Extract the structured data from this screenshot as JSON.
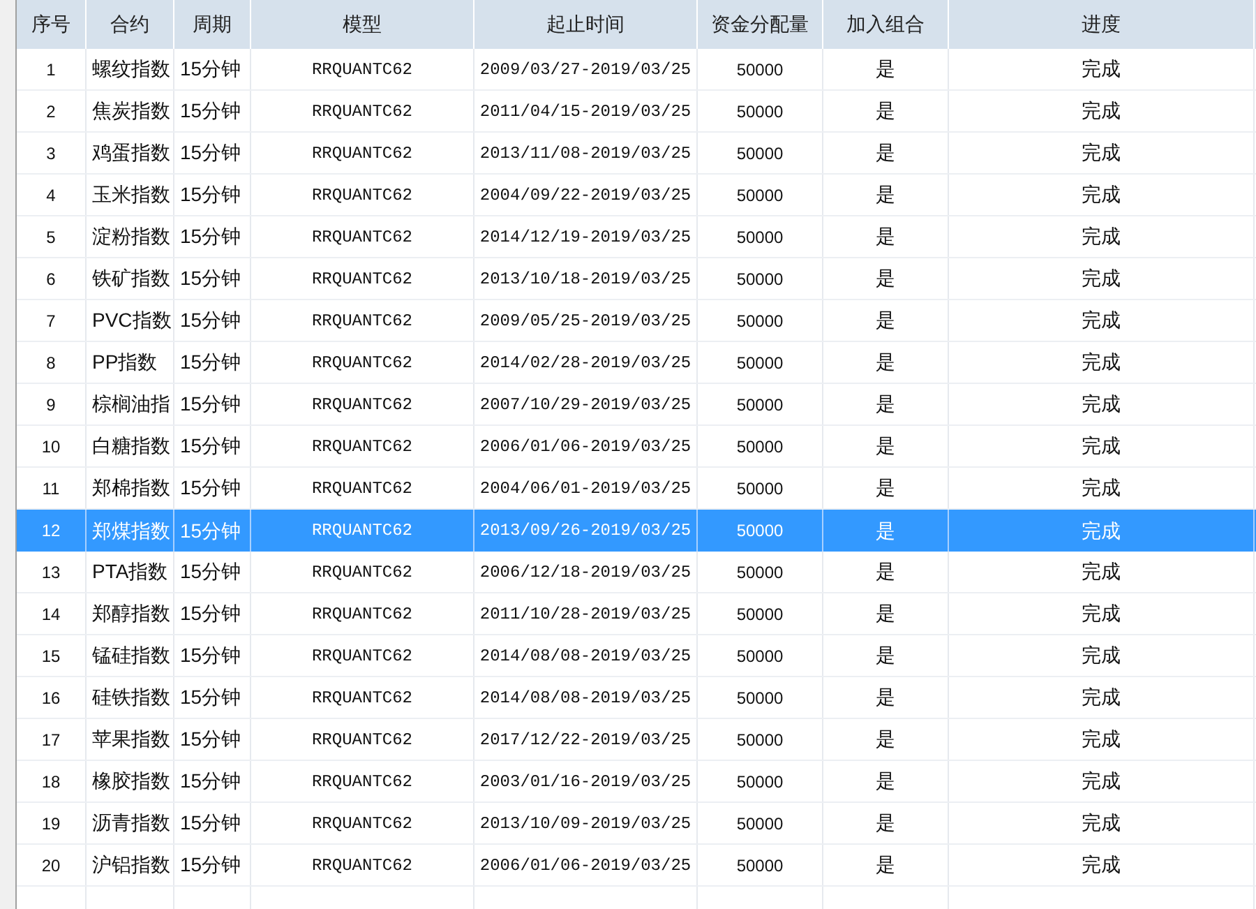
{
  "table": {
    "columns": [
      "序号",
      "合约",
      "周期",
      "模型",
      "起止时间",
      "资金分配量",
      "加入组合",
      "进度"
    ],
    "rows": [
      {
        "cells": [
          "1",
          "螺纹指数",
          "15分钟",
          "RRQUANTC62",
          "2009/03/27-2019/03/25",
          "50000",
          "是",
          "完成"
        ],
        "selected": false
      },
      {
        "cells": [
          "2",
          "焦炭指数",
          "15分钟",
          "RRQUANTC62",
          "2011/04/15-2019/03/25",
          "50000",
          "是",
          "完成"
        ],
        "selected": false
      },
      {
        "cells": [
          "3",
          "鸡蛋指数",
          "15分钟",
          "RRQUANTC62",
          "2013/11/08-2019/03/25",
          "50000",
          "是",
          "完成"
        ],
        "selected": false
      },
      {
        "cells": [
          "4",
          "玉米指数",
          "15分钟",
          "RRQUANTC62",
          "2004/09/22-2019/03/25",
          "50000",
          "是",
          "完成"
        ],
        "selected": false
      },
      {
        "cells": [
          "5",
          "淀粉指数",
          "15分钟",
          "RRQUANTC62",
          "2014/12/19-2019/03/25",
          "50000",
          "是",
          "完成"
        ],
        "selected": false
      },
      {
        "cells": [
          "6",
          "铁矿指数",
          "15分钟",
          "RRQUANTC62",
          "2013/10/18-2019/03/25",
          "50000",
          "是",
          "完成"
        ],
        "selected": false
      },
      {
        "cells": [
          "7",
          "PVC指数",
          "15分钟",
          "RRQUANTC62",
          "2009/05/25-2019/03/25",
          "50000",
          "是",
          "完成"
        ],
        "selected": false
      },
      {
        "cells": [
          "8",
          "PP指数",
          "15分钟",
          "RRQUANTC62",
          "2014/02/28-2019/03/25",
          "50000",
          "是",
          "完成"
        ],
        "selected": false
      },
      {
        "cells": [
          "9",
          "棕榈油指",
          "15分钟",
          "RRQUANTC62",
          "2007/10/29-2019/03/25",
          "50000",
          "是",
          "完成"
        ],
        "selected": false
      },
      {
        "cells": [
          "10",
          "白糖指数",
          "15分钟",
          "RRQUANTC62",
          "2006/01/06-2019/03/25",
          "50000",
          "是",
          "完成"
        ],
        "selected": false
      },
      {
        "cells": [
          "11",
          "郑棉指数",
          "15分钟",
          "RRQUANTC62",
          "2004/06/01-2019/03/25",
          "50000",
          "是",
          "完成"
        ],
        "selected": false
      },
      {
        "cells": [
          "12",
          "郑煤指数",
          "15分钟",
          "RRQUANTC62",
          "2013/09/26-2019/03/25",
          "50000",
          "是",
          "完成"
        ],
        "selected": true
      },
      {
        "cells": [
          "13",
          "PTA指数",
          "15分钟",
          "RRQUANTC62",
          "2006/12/18-2019/03/25",
          "50000",
          "是",
          "完成"
        ],
        "selected": false
      },
      {
        "cells": [
          "14",
          "郑醇指数",
          "15分钟",
          "RRQUANTC62",
          "2011/10/28-2019/03/25",
          "50000",
          "是",
          "完成"
        ],
        "selected": false
      },
      {
        "cells": [
          "15",
          "锰硅指数",
          "15分钟",
          "RRQUANTC62",
          "2014/08/08-2019/03/25",
          "50000",
          "是",
          "完成"
        ],
        "selected": false
      },
      {
        "cells": [
          "16",
          "硅铁指数",
          "15分钟",
          "RRQUANTC62",
          "2014/08/08-2019/03/25",
          "50000",
          "是",
          "完成"
        ],
        "selected": false
      },
      {
        "cells": [
          "17",
          "苹果指数",
          "15分钟",
          "RRQUANTC62",
          "2017/12/22-2019/03/25",
          "50000",
          "是",
          "完成"
        ],
        "selected": false
      },
      {
        "cells": [
          "18",
          "橡胶指数",
          "15分钟",
          "RRQUANTC62",
          "2003/01/16-2019/03/25",
          "50000",
          "是",
          "完成"
        ],
        "selected": false
      },
      {
        "cells": [
          "19",
          "沥青指数",
          "15分钟",
          "RRQUANTC62",
          "2013/10/09-2019/03/25",
          "50000",
          "是",
          "完成"
        ],
        "selected": false
      },
      {
        "cells": [
          "20",
          "沪铝指数",
          "15分钟",
          "RRQUANTC62",
          "2006/01/06-2019/03/25",
          "50000",
          "是",
          "完成"
        ],
        "selected": false
      }
    ]
  }
}
